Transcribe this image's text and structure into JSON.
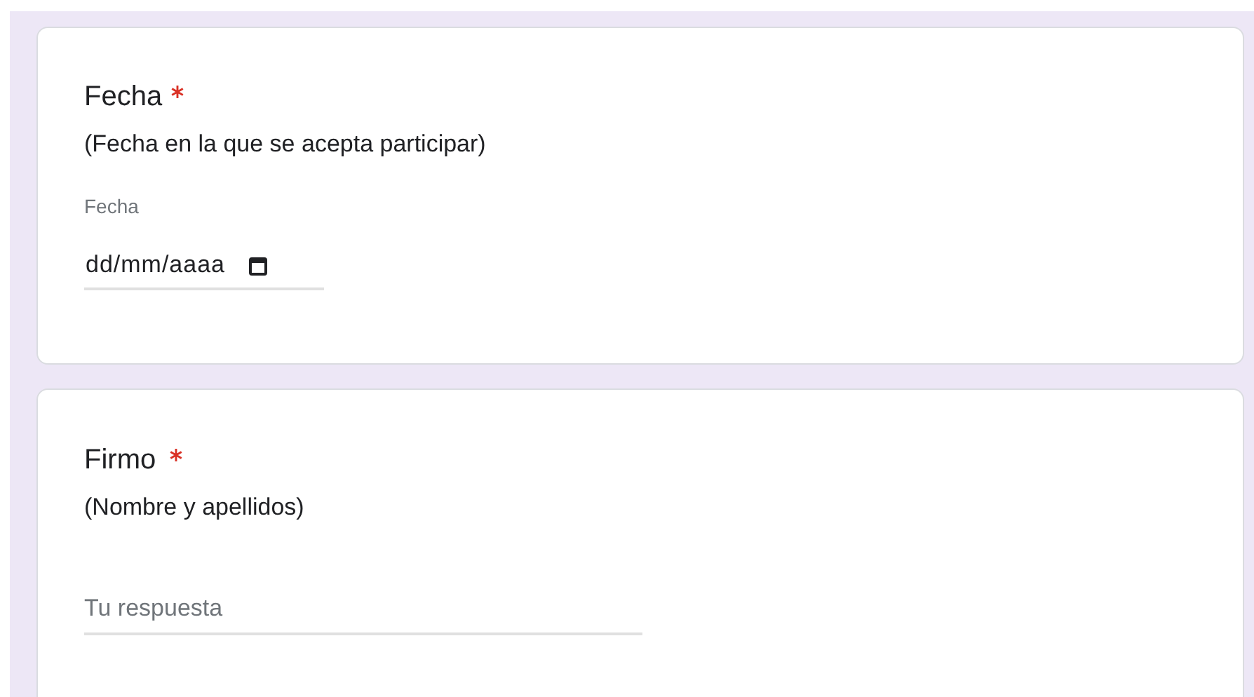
{
  "questions": [
    {
      "kind": "date",
      "title": "Fecha",
      "required": true,
      "description": "(Fecha en la que se acepta participar)",
      "field_label": "Fecha",
      "value": "dd/mm/aaaa"
    },
    {
      "kind": "text",
      "title": "Firmo",
      "required": true,
      "description": "(Nombre y apellidos)",
      "placeholder": "Tu respuesta"
    }
  ]
}
